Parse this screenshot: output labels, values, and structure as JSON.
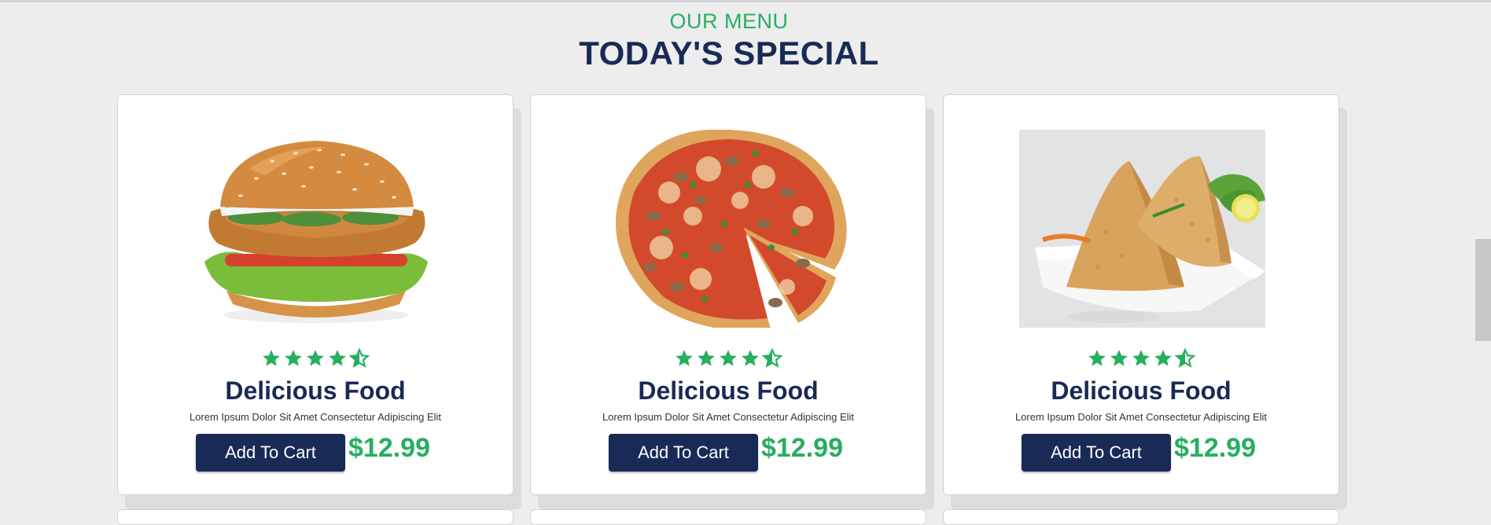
{
  "section": {
    "subtitle": "OUR MENU",
    "title": "TODAY'S SPECIAL"
  },
  "colors": {
    "accent": "#27ae60",
    "navy": "#192a56",
    "background": "#ededed"
  },
  "rating": {
    "value": 4.5,
    "max": 5
  },
  "cards": [
    {
      "image": "burger-image",
      "rating": 4.5,
      "name": "Delicious Food",
      "description": "Lorem Ipsum Dolor Sit Amet Consectetur Adipiscing Elit",
      "button_label": "Add To Cart",
      "price": "$12.99"
    },
    {
      "image": "pizza-image",
      "rating": 4.5,
      "name": "Delicious Food",
      "description": "Lorem Ipsum Dolor Sit Amet Consectetur Adipiscing Elit",
      "button_label": "Add To Cart",
      "price": "$12.99"
    },
    {
      "image": "samosa-image",
      "rating": 4.5,
      "name": "Delicious Food",
      "description": "Lorem Ipsum Dolor Sit Amet Consectetur Adipiscing Elit",
      "button_label": "Add To Cart",
      "price": "$12.99"
    }
  ]
}
